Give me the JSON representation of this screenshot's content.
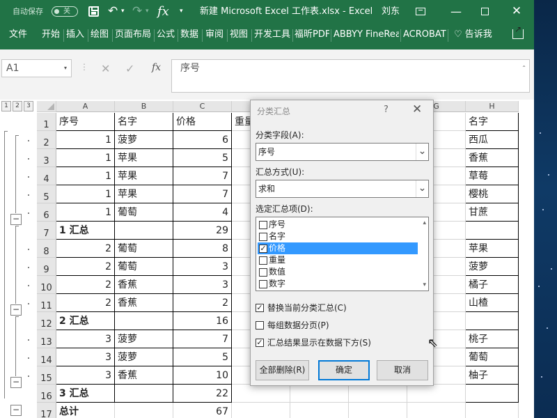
{
  "titlebar": {
    "autosave_label": "自动保存",
    "autosave_state": "关",
    "undo_icon": "↶",
    "redo_icon": "↷",
    "dropdown_arrow": "▾",
    "fx_icon": "fx",
    "qat_more": "▾",
    "doc_title": "新建 Microsoft Excel 工作表.xlsx  -  Excel",
    "user_name": "刘东",
    "minimize": "—",
    "close": "✕",
    "accent_color": "#217346"
  },
  "ribbon": {
    "tabs": [
      "文件",
      "开始",
      "插入",
      "绘图",
      "页面布局",
      "公式",
      "数据",
      "审阅",
      "视图",
      "开发工具",
      "福昕PDF",
      "ABBYY FineReader",
      "ACROBAT"
    ],
    "tell_me": "♡ 告诉我"
  },
  "formula_bar": {
    "name_box": "A1",
    "name_box_arrow": "▾",
    "dots": "⋮",
    "cancel_icon": "✕",
    "enter_icon": "✓",
    "insert_function_icon": "fx",
    "formula": "序号",
    "expand_icon": "⌃"
  },
  "grid": {
    "outline_levels": [
      "1",
      "2",
      "3"
    ],
    "columns": [
      "A",
      "B",
      "C",
      "",
      "",
      "",
      "G",
      "H"
    ],
    "row_numbers": [
      "1",
      "2",
      "3",
      "4",
      "5",
      "6",
      "7",
      "8",
      "9",
      "10",
      "11",
      "12",
      "13",
      "14",
      "15",
      "16",
      "17"
    ],
    "collapse_symbol": "−",
    "rows": [
      [
        "序号",
        "名字",
        "价格",
        "重量"
      ],
      [
        "1",
        "菠萝",
        "6",
        ""
      ],
      [
        "1",
        "苹果",
        "5",
        ""
      ],
      [
        "1",
        "苹果",
        "7",
        ""
      ],
      [
        "1",
        "苹果",
        "7",
        ""
      ],
      [
        "1",
        "葡萄",
        "4",
        ""
      ],
      [
        "1 汇总",
        "",
        "29",
        ""
      ],
      [
        "2",
        "葡萄",
        "8",
        ""
      ],
      [
        "2",
        "葡萄",
        "3",
        ""
      ],
      [
        "2",
        "香蕉",
        "3",
        ""
      ],
      [
        "2",
        "香蕉",
        "2",
        ""
      ],
      [
        "2 汇总",
        "",
        "16",
        ""
      ],
      [
        "3",
        "菠萝",
        "7",
        ""
      ],
      [
        "3",
        "菠萝",
        "5",
        ""
      ],
      [
        "3",
        "香蕉",
        "10",
        ""
      ],
      [
        "3 汇总",
        "",
        "22",
        ""
      ],
      [
        "总计",
        "",
        "67",
        ""
      ]
    ],
    "col_h": [
      "名字",
      "西瓜",
      "香蕉",
      "草莓",
      "樱桃",
      "甘蔗",
      "",
      "苹果",
      "菠萝",
      "橘子",
      "山楂",
      "",
      "桃子",
      "葡萄",
      "柚子",
      "",
      ""
    ]
  },
  "dialog": {
    "title": "分类汇总",
    "help": "?",
    "close": "✕",
    "group_field_label": "分类字段(A):",
    "group_field_value": "序号",
    "function_label": "汇总方式(U):",
    "function_value": "求和",
    "items_label": "选定汇总项(D):",
    "select_arrow": "⌄",
    "scroll_up": "▴",
    "scroll_down": "▾",
    "items": [
      {
        "label": "序号",
        "checked": false,
        "selected": false
      },
      {
        "label": "名字",
        "checked": false,
        "selected": false
      },
      {
        "label": "价格",
        "checked": true,
        "selected": true
      },
      {
        "label": "重量",
        "checked": false,
        "selected": false
      },
      {
        "label": "数值",
        "checked": false,
        "selected": false
      },
      {
        "label": "数字",
        "checked": false,
        "selected": false
      }
    ],
    "check_mark": "✓",
    "replace_current": "替换当前分类汇总(C)",
    "page_break": "每组数据分页(P)",
    "summary_below": "汇总结果显示在数据下方(S)",
    "remove_all": "全部删除(R)",
    "ok": "确定",
    "cancel": "取消"
  },
  "cursor_icon": "⇖"
}
